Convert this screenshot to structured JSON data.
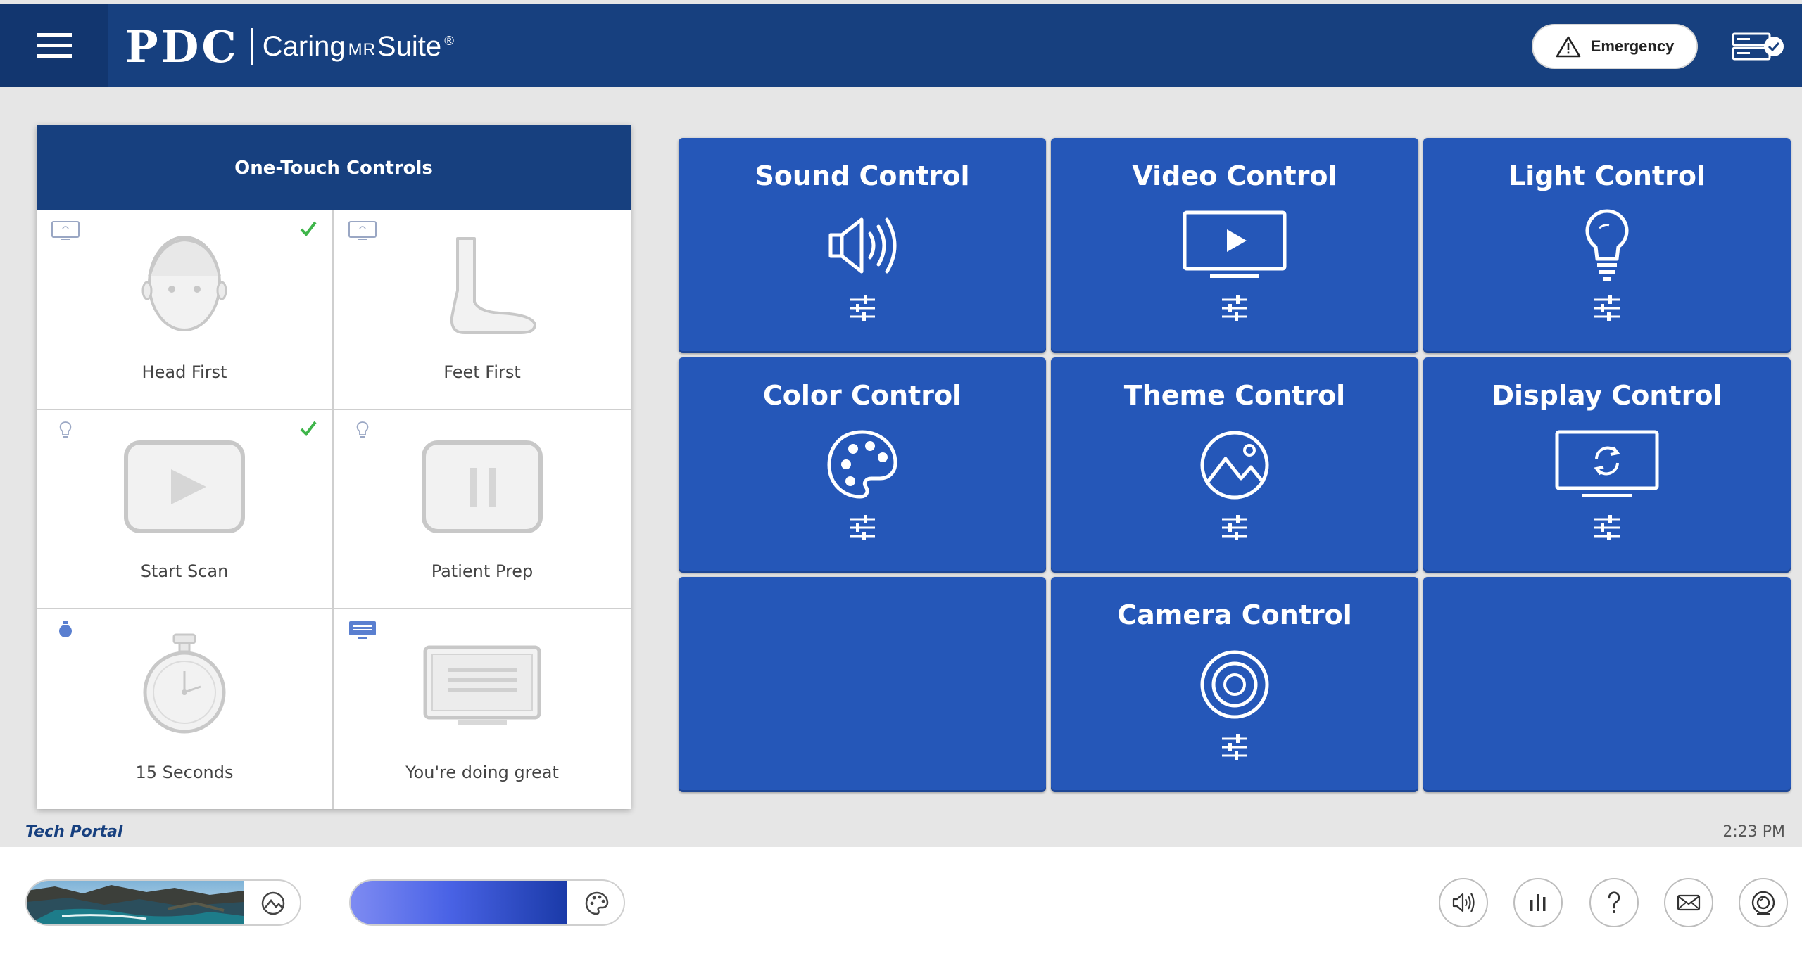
{
  "header": {
    "logo_pdc": "PDC",
    "logo_caring": "Caring",
    "logo_mr": "MR",
    "logo_suite": "Suite",
    "logo_reg": "®",
    "emergency_label": "Emergency",
    "icons": {
      "menu": "hamburger-icon",
      "warning": "warning-triangle-icon",
      "status": "server-status-icon"
    }
  },
  "one_touch": {
    "title": "One-Touch Controls",
    "cells": [
      {
        "label": "Head First",
        "type_icon": "display-icon",
        "checked": true,
        "illustration": "head-icon"
      },
      {
        "label": "Feet First",
        "type_icon": "display-icon",
        "checked": false,
        "illustration": "foot-icon"
      },
      {
        "label": "Start Scan",
        "type_icon": "lightbulb-icon",
        "checked": true,
        "illustration": "play-icon"
      },
      {
        "label": "Patient Prep",
        "type_icon": "lightbulb-icon",
        "checked": false,
        "illustration": "pause-icon"
      },
      {
        "label": "15 Seconds",
        "type_icon": "timer-icon",
        "checked": false,
        "illustration": "stopwatch-icon"
      },
      {
        "label": "You're doing great",
        "type_icon": "message-icon",
        "checked": false,
        "illustration": "message-screen-icon"
      }
    ]
  },
  "tiles": [
    {
      "title": "Sound Control",
      "icon": "speaker-icon"
    },
    {
      "title": "Video Control",
      "icon": "video-screen-icon"
    },
    {
      "title": "Light Control",
      "icon": "lightbulb-icon"
    },
    {
      "title": "Color Control",
      "icon": "palette-icon"
    },
    {
      "title": "Theme Control",
      "icon": "mountain-image-icon"
    },
    {
      "title": "Display Control",
      "icon": "display-refresh-icon"
    },
    {
      "title": "",
      "icon": ""
    },
    {
      "title": "Camera Control",
      "icon": "camera-icon"
    },
    {
      "title": "",
      "icon": ""
    }
  ],
  "footer": {
    "tech_portal": "Tech Portal",
    "time": "2:23 PM"
  },
  "bottom_bar": {
    "scene_button_icon": "theme-icon",
    "color_button_icon": "palette-icon",
    "nav_icons": [
      "speaker-icon",
      "equalizer-icon",
      "help-icon",
      "mail-icon",
      "camera-icon"
    ]
  },
  "colors": {
    "header": "#17407f",
    "tile": "#2557b8",
    "check": "#3fb54a",
    "background": "#e6e6e6"
  }
}
